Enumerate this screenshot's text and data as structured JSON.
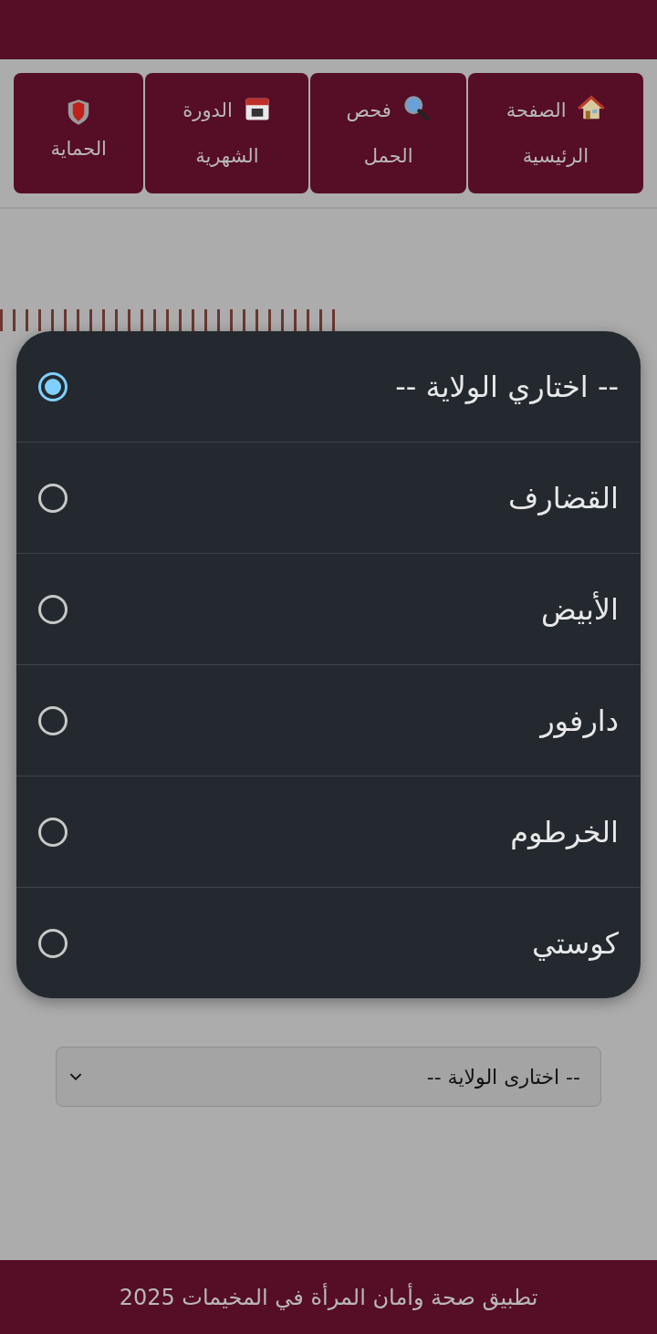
{
  "nav": [
    {
      "label": "الصفحة الرئيسية"
    },
    {
      "label": "فحص الحمل"
    },
    {
      "label": "الدورة الشهرية"
    },
    {
      "label": "الحماية"
    }
  ],
  "state_select": {
    "value": "-- اختارى الولاية --"
  },
  "dialog": {
    "options": [
      {
        "label": "-- اختاري الولاية --",
        "selected": true
      },
      {
        "label": "القضارف",
        "selected": false
      },
      {
        "label": "الأبيض",
        "selected": false
      },
      {
        "label": "دارفور",
        "selected": false
      },
      {
        "label": "الخرطوم",
        "selected": false
      },
      {
        "label": "كوستي",
        "selected": false
      }
    ]
  },
  "footer": "تطبيق صحة وأمان المرأة في المخيمات 2025"
}
